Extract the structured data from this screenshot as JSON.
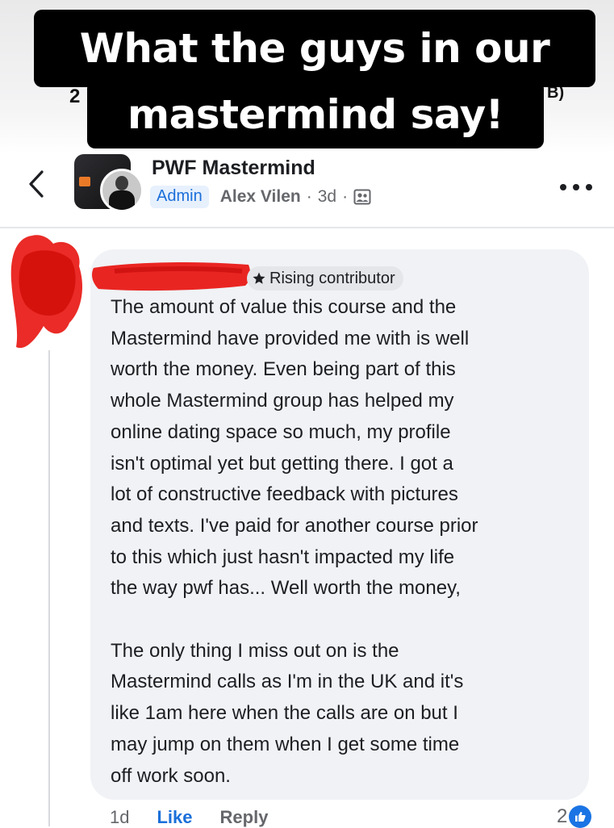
{
  "caption": {
    "line1": "What the guys in our",
    "line2": "mastermind say!"
  },
  "background_peek": {
    "left": "2",
    "right": "B)"
  },
  "post_header": {
    "group_name": "PWF Mastermind",
    "admin_label": "Admin",
    "author": "Alex Vilen",
    "separator": "·",
    "time": "3d",
    "visibility_icon": "members-icon"
  },
  "comment": {
    "badge": "Rising contributor",
    "text": "The amount of value this course and the\nMastermind have provided me with is well\nworth the money. Even being part of this\nwhole Mastermind group has helped my\nonline dating space so much, my profile\nisn't optimal yet but getting there. I got a\nlot of constructive feedback with pictures\nand texts. I've paid for another course prior\nto this which just hasn't impacted my life\nthe way pwf has... Well worth the money,\n\nThe only thing I miss out on is the\nMastermind calls as I'm in the UK and it's\nlike 1am here when the calls are on but I\nmay jump on them when I get some time\noff work soon.",
    "time": "1d",
    "like_label": "Like",
    "reply_label": "Reply",
    "reaction_count": "2"
  },
  "colors": {
    "accent": "#1b6fd9",
    "bubble": "#f0f2f5",
    "redaction": "#e8140f"
  }
}
